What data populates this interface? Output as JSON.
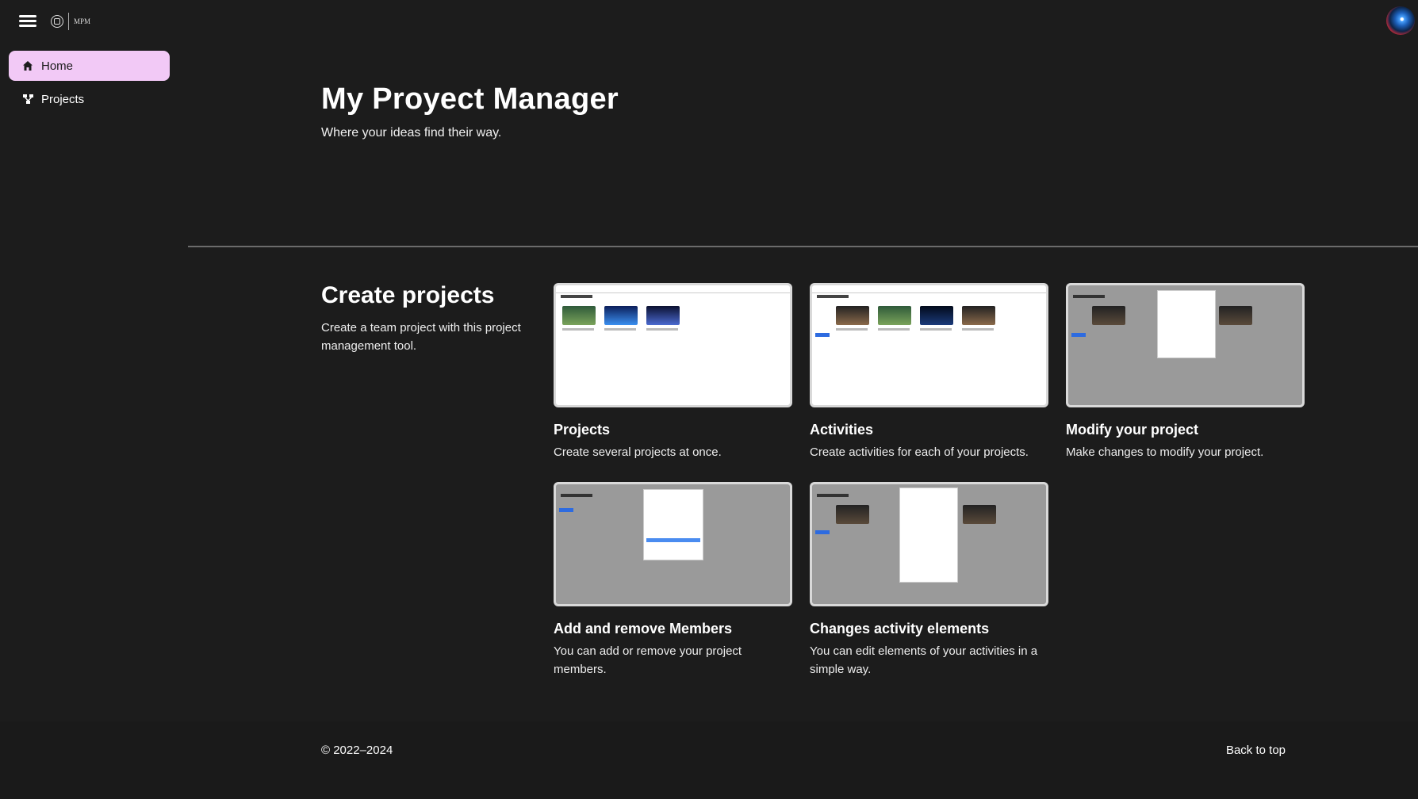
{
  "header": {
    "menu_icon": "hamburger-icon",
    "logo_text": "MPM",
    "avatar_alt": "user-avatar"
  },
  "sidebar": {
    "items": [
      {
        "label": "Home",
        "icon": "home-icon",
        "active": true
      },
      {
        "label": "Projects",
        "icon": "projects-icon",
        "active": false
      }
    ]
  },
  "hero": {
    "title": "My Proyect Manager",
    "subtitle": "Where your ideas find their way."
  },
  "features": {
    "title": "Create projects",
    "description": "Create a team project with this project management tool.",
    "cards": [
      {
        "title": "Projects",
        "description": "Create several projects at once."
      },
      {
        "title": "Activities",
        "description": "Create activities for each of your projects."
      },
      {
        "title": "Modify your project",
        "description": "Make changes to modify your project."
      },
      {
        "title": "Add and remove Members",
        "description": "You can add or remove your project members."
      },
      {
        "title": "Changes activity elements",
        "description": "You can edit elements of your activities in a simple way."
      }
    ]
  },
  "footer": {
    "copyright": "© 2022–2024",
    "back_to_top": "Back to top"
  },
  "colors": {
    "background": "#1c1c1c",
    "active_nav": "#f2c9f6",
    "divider": "#6b6b6b"
  }
}
